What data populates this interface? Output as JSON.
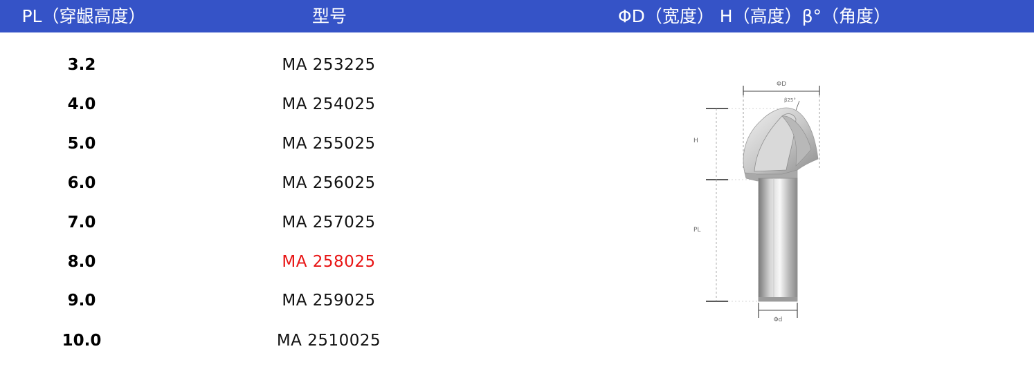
{
  "header": {
    "col_pl": "PL（穿龈高度）",
    "col_model": "型号",
    "col_dims": "ΦD（宽度） H（高度）β°（角度）"
  },
  "rows": [
    {
      "pl": "3.2",
      "model": "MA 253225"
    },
    {
      "pl": "4.0",
      "model": "MA 254025"
    },
    {
      "pl": "5.0",
      "model": "MA 255025"
    },
    {
      "pl": "6.0",
      "model": "MA 256025"
    },
    {
      "pl": "7.0",
      "model": "MA 257025"
    },
    {
      "pl": "8.0",
      "model": "MA 258025",
      "highlight": "#e81414"
    },
    {
      "pl": "9.0",
      "model": "MA 259025"
    },
    {
      "pl": "10.0",
      "model": "MA 2510025"
    }
  ],
  "diagram": {
    "label_D": "ΦD",
    "label_angle": "β25°",
    "label_H": "H",
    "label_PL": "PL",
    "label_d": "Φd"
  },
  "colors": {
    "header_bg": "#3553c7",
    "header_text": "#ffffff",
    "highlight": "#e81414"
  }
}
